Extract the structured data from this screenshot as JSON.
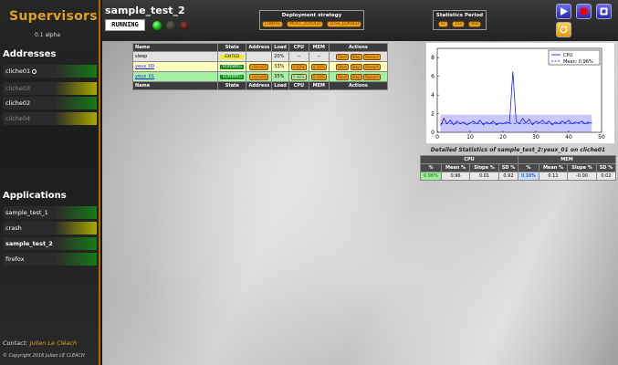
{
  "sidebar": {
    "title": "Supervisors",
    "version": "0.1 alpha",
    "addresses_heading": "Addresses",
    "addresses": [
      {
        "label": "cliche01",
        "status": "green",
        "active": true
      },
      {
        "label": "cliche03",
        "status": "yellow",
        "active": false
      },
      {
        "label": "cliche02",
        "status": "green",
        "active": true
      },
      {
        "label": "cliche04",
        "status": "yellow",
        "active": false
      }
    ],
    "applications_heading": "Applications",
    "applications": [
      {
        "label": "sample_test_1",
        "status": "green"
      },
      {
        "label": "crash",
        "status": "yellow"
      },
      {
        "label": "sample_test_2",
        "status": "green"
      },
      {
        "label": "firefox",
        "status": "green"
      }
    ],
    "contact_label": "Contact:",
    "contact_name": "Julien Le Cléach",
    "copyright": "© Copyright 2016 Julien LE CLEACH"
  },
  "header": {
    "app_name": "sample_test_2",
    "state": "RUNNING",
    "deployment_title": "Deployment strategy",
    "deployment_options": [
      "CONFIG",
      "MOST_LOADED",
      "LESS_LOADED"
    ],
    "period_title": "Statistics Period",
    "period_options": [
      "5s",
      "15s",
      "60s"
    ]
  },
  "process_table": {
    "headers": [
      "Name",
      "State",
      "Address",
      "Load",
      "CPU",
      "MEM",
      "Actions"
    ],
    "rows": [
      {
        "name": "sleep",
        "state": "EXITED",
        "address": "",
        "load": "20%",
        "cpu": "--",
        "mem": "--",
        "link": false
      },
      {
        "name": "yeux_00",
        "state": "RUNNING",
        "address": "cliche01",
        "load": "33%",
        "cpu": "0.62%",
        "mem": "0.10%",
        "link": true
      },
      {
        "name": "yeux_01",
        "state": "RUNNING",
        "address": "cliche01",
        "load": "35%",
        "cpu": "0.96%",
        "mem": "0.10%",
        "link": true
      }
    ],
    "actions": [
      "Start",
      "Stop",
      "Restart"
    ]
  },
  "stats": {
    "caption": "Detailed Statistics of sample_test_2:yeux_01 on cliche01",
    "cpu_heading": "CPU",
    "mem_heading": "MEM",
    "columns": [
      "%",
      "Mean %",
      "Slope %",
      "SD %"
    ],
    "cpu": [
      "0.96%",
      "0.96",
      "0.01",
      "0.92"
    ],
    "mem": [
      "0.10%",
      "0.11",
      "-0.00",
      "0.02"
    ]
  },
  "chart_data": {
    "type": "line",
    "title": "",
    "xlabel": "",
    "ylabel": "",
    "xlim": [
      0,
      50
    ],
    "ylim": [
      0,
      9
    ],
    "xticks": [
      0,
      10,
      20,
      30,
      40,
      50
    ],
    "yticks": [
      0,
      2,
      4,
      6,
      8
    ],
    "legend_position": "top-right",
    "series": [
      {
        "name": "CPU",
        "color": "#0000ff",
        "x": [
          1,
          2,
          3,
          4,
          5,
          6,
          7,
          8,
          9,
          10,
          11,
          12,
          13,
          14,
          15,
          16,
          17,
          18,
          19,
          20,
          21,
          22,
          23,
          24,
          25,
          26,
          27,
          28,
          29,
          30,
          31,
          32,
          33,
          34,
          35,
          36,
          37,
          38,
          39,
          40,
          41,
          42,
          43,
          44,
          45,
          46,
          47
        ],
        "y": [
          0.7,
          1.5,
          0.9,
          1.3,
          0.8,
          1.2,
          0.9,
          1.1,
          0.8,
          1.0,
          1.2,
          0.9,
          1.3,
          0.8,
          1.1,
          0.9,
          1.2,
          0.8,
          1.0,
          0.9,
          1.1,
          1.0,
          6.5,
          1.2,
          0.9,
          1.5,
          1.0,
          1.4,
          0.8,
          1.2,
          1.0,
          1.3,
          0.9,
          1.2,
          0.8,
          1.1,
          0.9,
          1.2,
          1.0,
          1.3,
          0.9,
          1.1,
          1.0,
          1.2,
          0.9,
          1.1,
          1.0
        ]
      },
      {
        "name": "Mean: 0.96%",
        "color": "#0000ff",
        "style": "dashed",
        "value": 0.96
      }
    ],
    "sd_band": [
      0.04,
      1.88
    ],
    "sd_band_color": "#b0b0ff"
  }
}
